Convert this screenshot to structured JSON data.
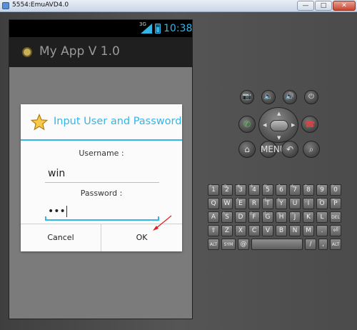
{
  "window": {
    "title": "5554:EmuAVD4.0",
    "minimize_label": "—",
    "maximize_label": "□",
    "close_label": "✕"
  },
  "statusbar": {
    "network": "3G",
    "time": "10:38"
  },
  "actionbar": {
    "title": "My App V 1.0"
  },
  "dialog": {
    "title": "Input User and Password",
    "username_label": "Username :",
    "username_value": "win",
    "password_label": "Password :",
    "password_value": "•••",
    "cancel_label": "Cancel",
    "ok_label": "OK"
  },
  "controls": {
    "camera": "📷",
    "vol_down": "🔈",
    "vol_up": "🔊",
    "power": "⏻",
    "call": "✆",
    "endcall": "☎",
    "home": "⌂",
    "menu": "MENU",
    "back": "↶",
    "search": "⌕"
  },
  "keyboard": {
    "row1": [
      "1",
      "2",
      "3",
      "4",
      "5",
      "6",
      "7",
      "8",
      "9",
      "0"
    ],
    "row1_sup": [
      "!",
      "@",
      "#",
      "$",
      "%",
      "^",
      "&",
      "*",
      "(",
      ")"
    ],
    "row2": [
      "Q",
      "W",
      "E",
      "R",
      "T",
      "Y",
      "U",
      "I",
      "O",
      "P"
    ],
    "row2_sup": [
      "",
      "~",
      "\"",
      "",
      "{",
      "}",
      "-",
      "_",
      "+",
      "="
    ],
    "row3": [
      "A",
      "S",
      "D",
      "F",
      "G",
      "H",
      "J",
      "K",
      "L",
      "DEL"
    ],
    "row3_sup": [
      "",
      "\\",
      "",
      "[",
      "]",
      "<",
      ">",
      ";",
      ":",
      ""
    ],
    "row4": [
      "⇧",
      "Z",
      "X",
      "C",
      "V",
      "B",
      "N",
      "M",
      ".",
      "⏎"
    ],
    "row4_sup": [
      "",
      "",
      "",
      "",
      "",
      "",
      "",
      "",
      "",
      ""
    ],
    "row5_alt1": "ALT",
    "row5_sym": "SYM",
    "row5_at": "@",
    "row5_space": "",
    "row5_slash": "/",
    "row5_comma": ",",
    "row5_alt2": "ALT"
  },
  "colors": {
    "accent": "#33b5e5"
  }
}
